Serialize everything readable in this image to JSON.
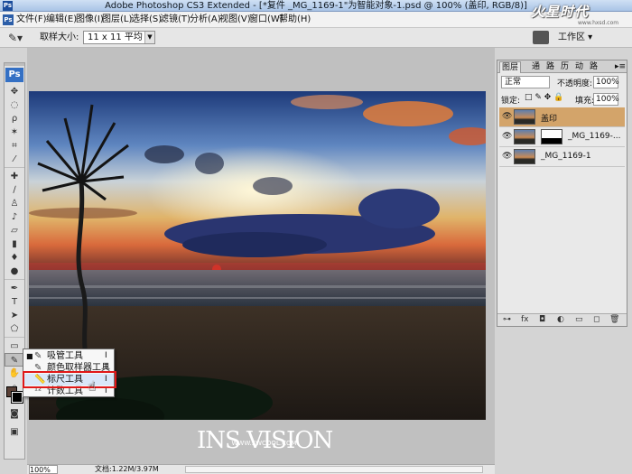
{
  "window": {
    "title": "Adobe Photoshop CS3 Extended - [*复件 _MG_1169-1\"为智能对象-1.psd @ 100% (盖印, RGB/8)]",
    "app_icon": "Ps"
  },
  "site_logo": {
    "text": "火星时代",
    "subtext": "www.hxsd.com"
  },
  "menu": {
    "items": [
      "文件(F)",
      "编辑(E)",
      "图像(I)",
      "图层(L)",
      "选择(S)",
      "滤镜(T)",
      "分析(A)",
      "视图(V)",
      "窗口(W)",
      "帮助(H)"
    ]
  },
  "options": {
    "sample_label": "取样大小:",
    "sample_value": "11 x 11 平均",
    "workspace_label": "工作区 ▾"
  },
  "toolbox": {
    "logo": "Ps",
    "tools": [
      "移动",
      "选框",
      "套索",
      "魔棒",
      "裁剪",
      "切片",
      "修复",
      "画笔",
      "图章",
      "历史",
      "橡皮",
      "渐变",
      "模糊",
      "减淡",
      "钢笔",
      "文字",
      "路径",
      "形状",
      "注释",
      "吸管",
      "抓手",
      "缩放"
    ]
  },
  "flyout": {
    "items": [
      {
        "label": "吸管工具",
        "key": "I",
        "icon": "eyedropper-icon",
        "active": true
      },
      {
        "label": "颜色取样器工具",
        "key": "I",
        "icon": "color-sampler-icon",
        "active": false
      },
      {
        "label": "标尺工具",
        "key": "I",
        "icon": "ruler-icon",
        "active": false
      },
      {
        "label": "计数工具",
        "key": "I",
        "icon": "count-icon",
        "active": false
      }
    ]
  },
  "photo_caption": {
    "main": "INS VISION",
    "sub": "WWW.SWCOOL.COM"
  },
  "status": {
    "zoom": "100%",
    "doc": "文档:1.22M/3.97M"
  },
  "layers_panel": {
    "tabs": [
      "图层",
      "通",
      "路",
      "历",
      "动",
      "路"
    ],
    "blend_mode": "正常",
    "opacity_label": "不透明度:",
    "opacity_value": "100%",
    "lock_label": "锁定:",
    "fill_label": "填充:",
    "fill_value": "100%",
    "layers": [
      {
        "name": "盖印",
        "selected": true,
        "has_mask": false
      },
      {
        "name": "_MG_1169-...",
        "selected": false,
        "has_mask": true
      },
      {
        "name": "_MG_1169-1",
        "selected": false,
        "has_mask": false
      }
    ],
    "footer_icons": [
      "link-icon",
      "fx-icon",
      "mask-icon",
      "adjustment-icon",
      "folder-icon",
      "new-layer-icon",
      "trash-icon"
    ]
  },
  "colors": {
    "highlight": "#e01818",
    "selected_layer": "#d3a46a",
    "foreground": "#5a4036",
    "background": "#000000"
  }
}
